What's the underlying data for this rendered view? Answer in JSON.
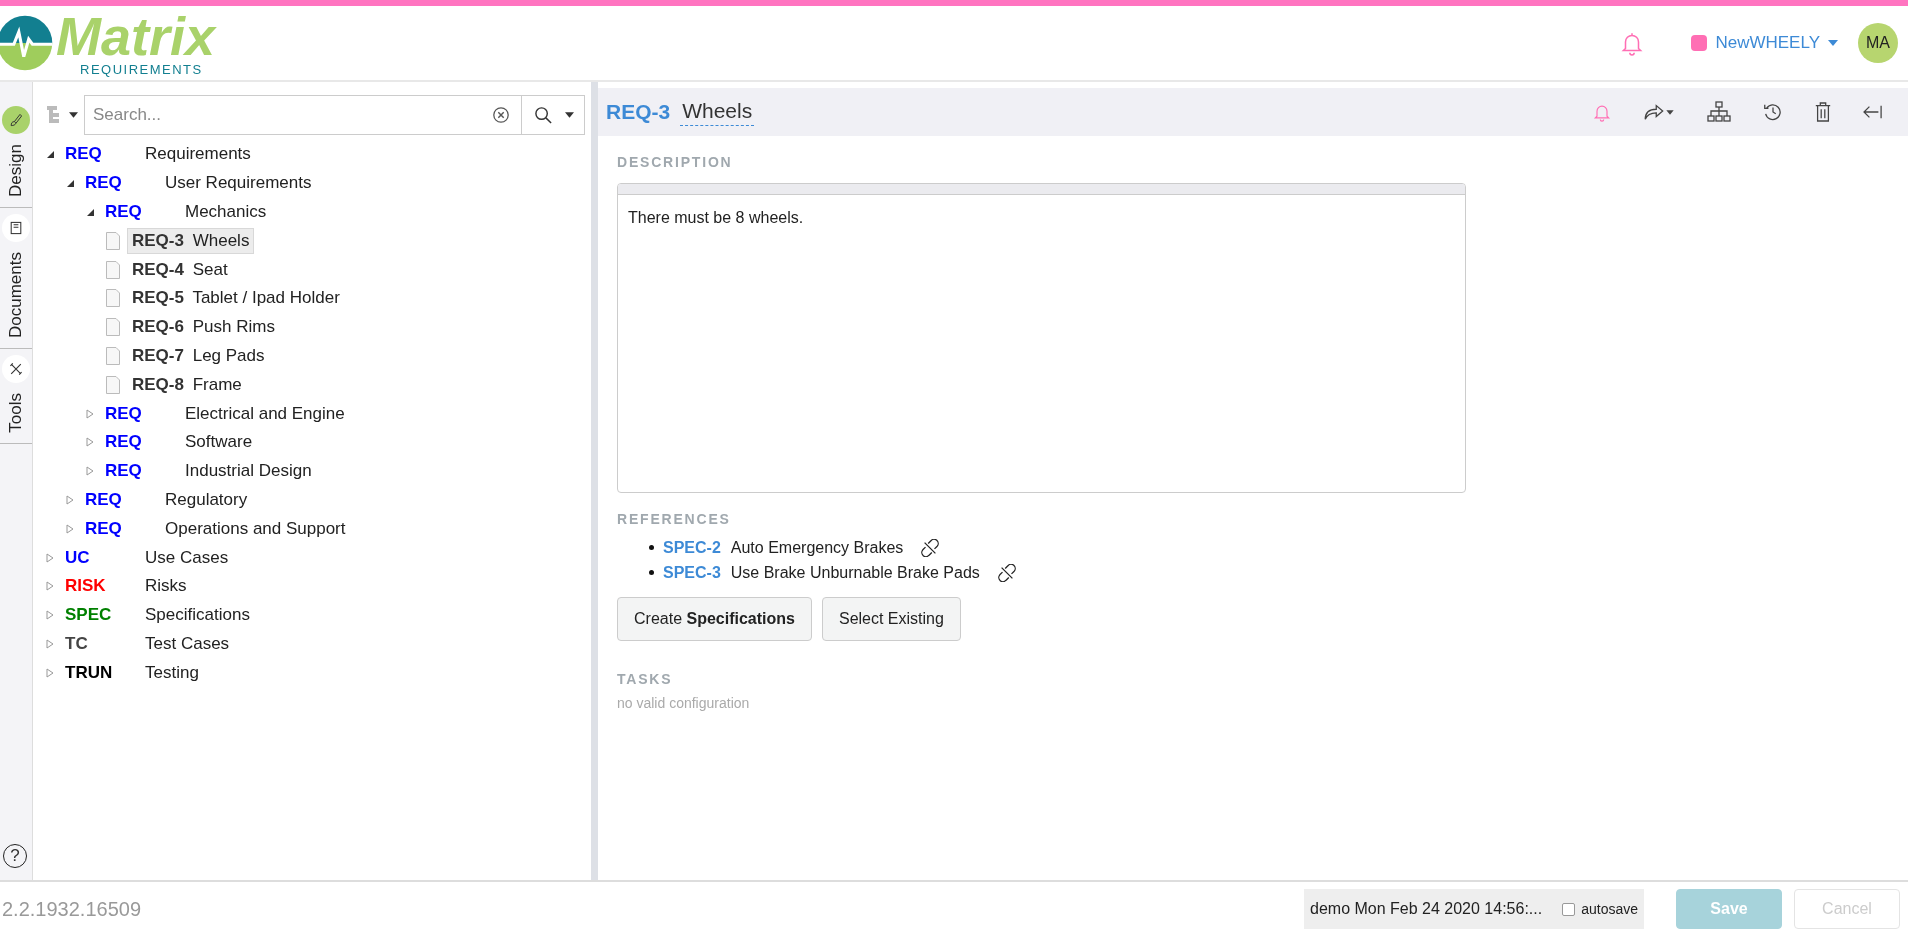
{
  "logo": {
    "name": "Matrix",
    "tagline": "REQUIREMENTS"
  },
  "header": {
    "project": {
      "name": "NewWHEELY",
      "color": "#ff6eb4"
    },
    "avatar": "MA"
  },
  "side_tabs": [
    {
      "label": "Design",
      "selected": true
    },
    {
      "label": "Documents",
      "selected": false
    },
    {
      "label": "Tools",
      "selected": false
    }
  ],
  "help": "?",
  "tree_search": {
    "placeholder": "Search..."
  },
  "tree": [
    {
      "kind": "folder",
      "prefix": "REQ",
      "color": "#0000ff",
      "label": "Requirements",
      "expanded": true,
      "selected": false,
      "children": [
        {
          "kind": "folder",
          "prefix": "REQ",
          "color": "#0000ff",
          "label": "User Requirements",
          "expanded": true,
          "selected": false,
          "children": [
            {
              "kind": "folder",
              "prefix": "REQ",
              "color": "#0000ff",
              "label": "Mechanics",
              "expanded": true,
              "selected": false,
              "children": [
                {
                  "kind": "item",
                  "id": "REQ-3",
                  "label": "Wheels",
                  "selected": true
                },
                {
                  "kind": "item",
                  "id": "REQ-4",
                  "label": "Seat",
                  "selected": false
                },
                {
                  "kind": "item",
                  "id": "REQ-5",
                  "label": "Tablet / Ipad Holder",
                  "selected": false
                },
                {
                  "kind": "item",
                  "id": "REQ-6",
                  "label": "Push Rims",
                  "selected": false
                },
                {
                  "kind": "item",
                  "id": "REQ-7",
                  "label": "Leg Pads",
                  "selected": false
                },
                {
                  "kind": "item",
                  "id": "REQ-8",
                  "label": "Frame",
                  "selected": false
                }
              ]
            },
            {
              "kind": "folder",
              "prefix": "REQ",
              "color": "#0000ff",
              "label": "Electrical and Engine",
              "expanded": false,
              "selected": false
            },
            {
              "kind": "folder",
              "prefix": "REQ",
              "color": "#0000ff",
              "label": "Software",
              "expanded": false,
              "selected": false
            },
            {
              "kind": "folder",
              "prefix": "REQ",
              "color": "#0000ff",
              "label": "Industrial Design",
              "expanded": false,
              "selected": false
            }
          ]
        },
        {
          "kind": "folder",
          "prefix": "REQ",
          "color": "#0000ff",
          "label": "Regulatory",
          "expanded": false,
          "selected": false
        },
        {
          "kind": "folder",
          "prefix": "REQ",
          "color": "#0000ff",
          "label": "Operations and Support",
          "expanded": false,
          "selected": false
        }
      ]
    },
    {
      "kind": "folder",
      "prefix": "UC",
      "color": "#0000ff",
      "label": "Use Cases",
      "expanded": false,
      "selected": false
    },
    {
      "kind": "folder",
      "prefix": "RISK",
      "color": "#ff0000",
      "label": "Risks",
      "expanded": false,
      "selected": false
    },
    {
      "kind": "folder",
      "prefix": "SPEC",
      "color": "#008000",
      "label": "Specifications",
      "expanded": false,
      "selected": false
    },
    {
      "kind": "folder",
      "prefix": "TC",
      "color": "#444444",
      "label": "Test Cases",
      "expanded": false,
      "selected": false
    },
    {
      "kind": "folder",
      "prefix": "TRUN",
      "color": "#000000",
      "label": "Testing",
      "expanded": false,
      "selected": false
    }
  ],
  "item": {
    "id": "REQ-3",
    "title": "Wheels",
    "description": {
      "label": "DESCRIPTION",
      "text": "There must be 8 wheels."
    },
    "references": {
      "label": "REFERENCES",
      "links": [
        {
          "id": "SPEC-2",
          "title": "Auto Emergency Brakes"
        },
        {
          "id": "SPEC-3",
          "title": "Use Brake Unburnable Brake Pads"
        }
      ]
    },
    "buttons": [
      {
        "label": "Create **Specifications**"
      },
      {
        "label": "Select Existing"
      }
    ],
    "tasks": {
      "label": "TASKS",
      "note": "no valid configuration"
    }
  },
  "footer": {
    "version": "2.2.1932.16509",
    "status": "demo Mon Feb 24 2020 14:56:...",
    "autosave": {
      "label": "autosave",
      "checked": false
    },
    "buttons": [
      {
        "label": "Save",
        "kind": "primary",
        "disabled": true
      },
      {
        "label": "Cancel",
        "kind": "default",
        "disabled": true
      }
    ]
  }
}
